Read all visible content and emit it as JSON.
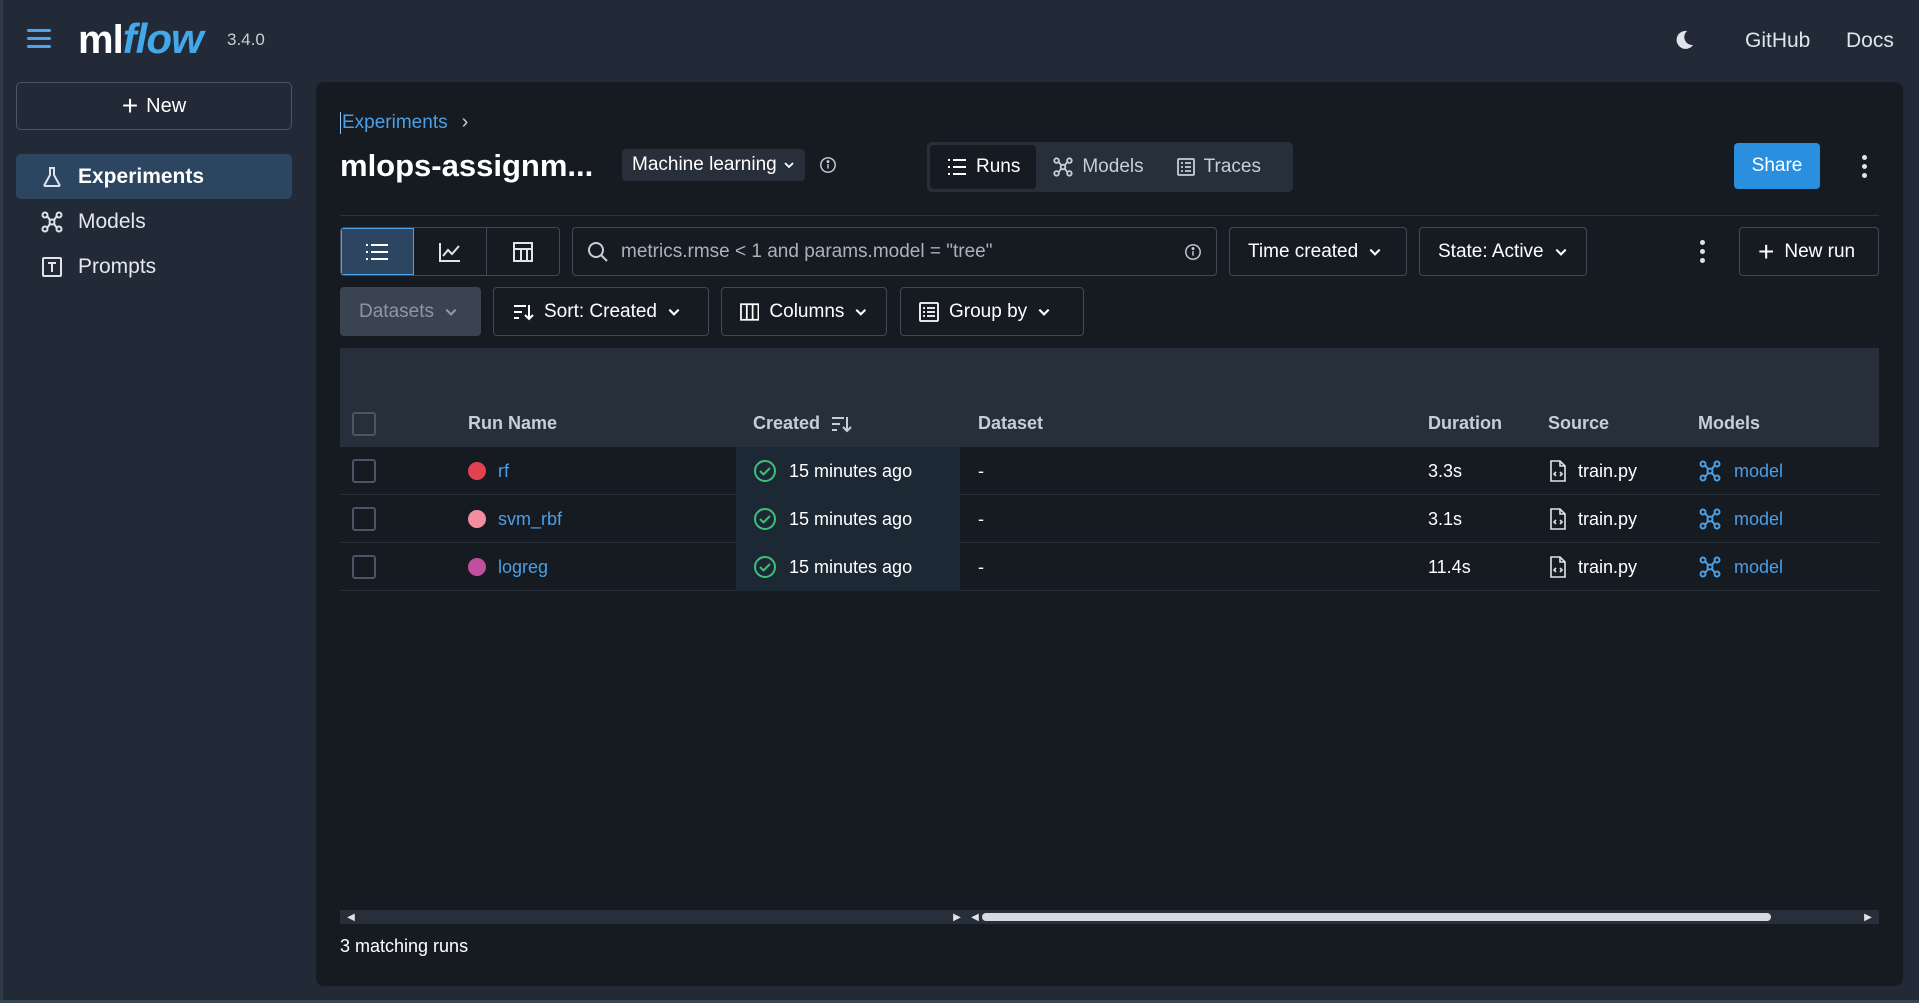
{
  "app": {
    "logo_ml": "ml",
    "logo_flow": "flow",
    "version": "3.4.0",
    "links": [
      "GitHub",
      "Docs"
    ]
  },
  "sidebar": {
    "new_label": "New",
    "items": [
      {
        "label": "Experiments",
        "icon": "flask-icon",
        "active": true
      },
      {
        "label": "Models",
        "icon": "models-icon",
        "active": false
      },
      {
        "label": "Prompts",
        "icon": "prompt-icon",
        "active": false
      }
    ]
  },
  "header": {
    "breadcrumb": "Experiments",
    "title": "mlops-assignm...",
    "tag": "Machine learning",
    "tabs": [
      {
        "label": "Runs",
        "icon": "list-icon",
        "active": true
      },
      {
        "label": "Models",
        "icon": "models-icon",
        "active": false
      },
      {
        "label": "Traces",
        "icon": "traces-icon",
        "active": false
      }
    ],
    "share_label": "Share"
  },
  "toolbar": {
    "search_placeholder": "metrics.rmse < 1 and params.model = \"tree\"",
    "time_filter": "Time created",
    "state_filter": "State: Active",
    "new_run_label": "New run",
    "datasets_label": "Datasets",
    "sort_label": "Sort: Created",
    "columns_label": "Columns",
    "group_by_label": "Group by"
  },
  "table": {
    "columns": [
      "Run Name",
      "Created",
      "Dataset",
      "Duration",
      "Source",
      "Models"
    ],
    "rows": [
      {
        "name": "rf",
        "color": "#e0434f",
        "created": "15 minutes ago",
        "dataset": "-",
        "duration": "3.3s",
        "source": "train.py",
        "model": "model"
      },
      {
        "name": "svm_rbf",
        "color": "#f28ea0",
        "created": "15 minutes ago",
        "dataset": "-",
        "duration": "3.1s",
        "source": "train.py",
        "model": "model"
      },
      {
        "name": "logreg",
        "color": "#c04fa0",
        "created": "15 minutes ago",
        "dataset": "-",
        "duration": "11.4s",
        "source": "train.py",
        "model": "model"
      }
    ],
    "footer": "3 matching runs"
  },
  "colors": {
    "accent": "#2b8fe0",
    "link": "#4b9fe6",
    "success": "#3fbf7a"
  }
}
